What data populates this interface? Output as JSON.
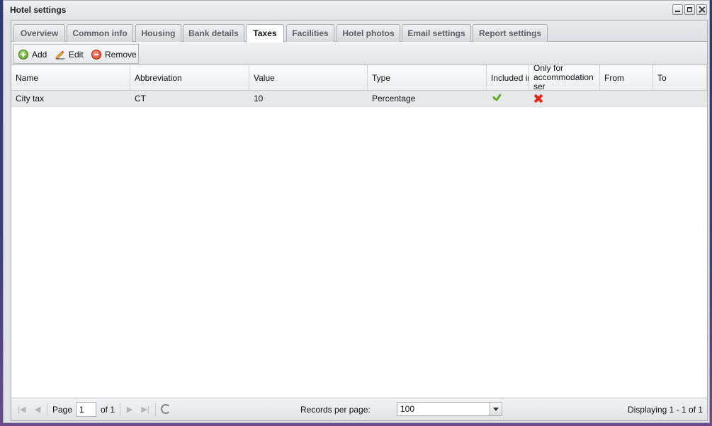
{
  "window": {
    "title": "Hotel settings"
  },
  "tabs": [
    {
      "label": "Overview"
    },
    {
      "label": "Common info"
    },
    {
      "label": "Housing"
    },
    {
      "label": "Bank details"
    },
    {
      "label": "Taxes",
      "active": true
    },
    {
      "label": "Facilities"
    },
    {
      "label": "Hotel photos"
    },
    {
      "label": "Email settings"
    },
    {
      "label": "Report settings"
    }
  ],
  "toolbar": {
    "add_label": "Add",
    "edit_label": "Edit",
    "remove_label": "Remove"
  },
  "grid": {
    "columns": [
      {
        "label": "Name"
      },
      {
        "label": "Abbreviation"
      },
      {
        "label": "Value"
      },
      {
        "label": "Type"
      },
      {
        "label": "Included in"
      },
      {
        "label": "Only for accommodation ser"
      },
      {
        "label": "From"
      },
      {
        "label": "To"
      }
    ],
    "rows": [
      {
        "name": "City tax",
        "abbreviation": "CT",
        "value": "10",
        "type": "Percentage",
        "included_in": "checkmark-icon",
        "only_for_accommodation": "cross-icon",
        "from": "",
        "to": ""
      }
    ]
  },
  "pager": {
    "page_label": "Page",
    "page_value": "1",
    "of_label": "of 1",
    "records_label": "Records per page:",
    "records_value": "100",
    "display_text": "Displaying 1 - 1 of 1"
  }
}
